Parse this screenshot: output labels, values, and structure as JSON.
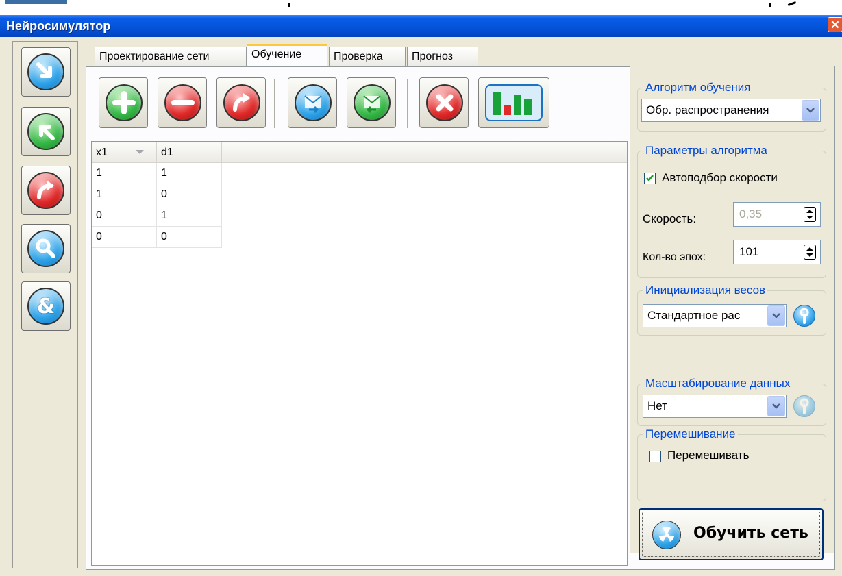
{
  "window": {
    "title": "Нейросимулятор",
    "close_glyph": "✕"
  },
  "sidebar": {
    "buttons": [
      {
        "icon": "arrow-down-right-icon",
        "color": "blue"
      },
      {
        "icon": "arrow-up-left-icon",
        "color": "green"
      },
      {
        "icon": "redo-arrow-icon",
        "color": "red"
      },
      {
        "icon": "magnifier-icon",
        "color": "blue"
      },
      {
        "icon": "ampersand-icon",
        "color": "blue"
      }
    ],
    "ampersand_glyph": "&"
  },
  "tabs": [
    {
      "label": "Проектирование сети",
      "active": false
    },
    {
      "label": "Обучение",
      "active": true
    },
    {
      "label": "Проверка",
      "active": false
    },
    {
      "label": "Прогноз",
      "active": false
    }
  ],
  "toolbar": {
    "buttons": [
      "plus-icon",
      "minus-icon",
      "redo-icon",
      "import-icon",
      "export-icon",
      "delete-icon",
      "bar-chart-icon"
    ]
  },
  "grid": {
    "columns": [
      "x1",
      "d1"
    ],
    "rows": [
      [
        "1",
        "1"
      ],
      [
        "1",
        "0"
      ],
      [
        "0",
        "1"
      ],
      [
        "0",
        "0"
      ]
    ]
  },
  "training_algorithm": {
    "legend": "Алгоритм обучения",
    "selected": "Обр. распространения"
  },
  "algorithm_params": {
    "legend": "Параметры алгоритма",
    "auto_speed_label": "Автоподбор скорости",
    "auto_speed_checked": true,
    "speed_label": "Скорость:",
    "speed_value": "0,35",
    "epochs_label": "Кол-во эпох:",
    "epochs_value": "101"
  },
  "weights_init": {
    "legend": "Инициализация весов",
    "selected": "Стандартное рас"
  },
  "data_scaling": {
    "legend": "Масштабирование данных",
    "selected": "Нет"
  },
  "shuffle": {
    "legend": "Перемешивание",
    "label": "Перемешивать",
    "checked": false
  },
  "train_button": {
    "label": "Обучить сеть"
  },
  "colors": {
    "title_bar": "#0453d8",
    "legend_text": "#0046d5",
    "tab_active_accent": "#ffc83c"
  }
}
